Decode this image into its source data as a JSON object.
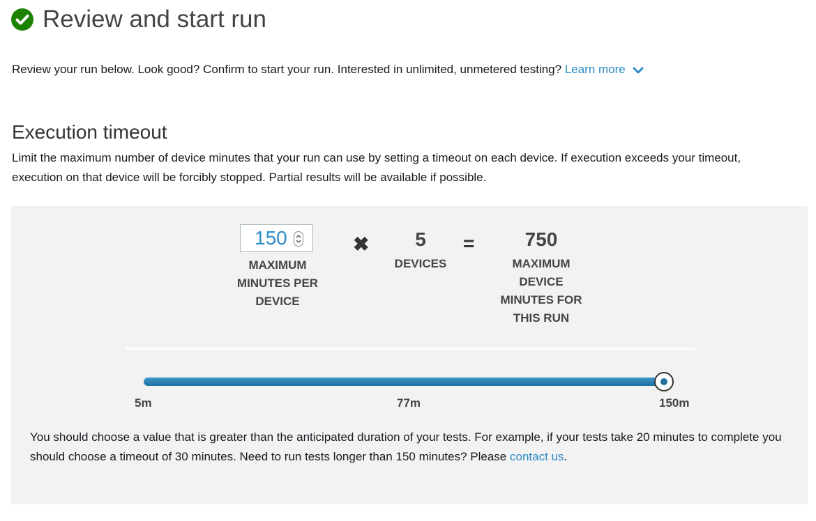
{
  "header": {
    "title": "Review and start run",
    "status_icon": "check-circle-icon",
    "accent_color": "#1d8102"
  },
  "intro": {
    "text": "Review your run below. Look good? Confirm to start your run. Interested in unlimited, unmetered testing? ",
    "link_label": "Learn more"
  },
  "execution_timeout": {
    "title": "Execution timeout",
    "description": "Limit the maximum number of device minutes that your run can use by setting a timeout on each device. If execution exceeds your timeout, execution on that device will be forcibly stopped. Partial results will be available if possible.",
    "minutes_per_device": {
      "value": "150",
      "label": "MAXIMUM MINUTES PER DEVICE"
    },
    "multiply_symbol": "✖",
    "devices": {
      "value": "5",
      "label": "DEVICES"
    },
    "equals_symbol": "=",
    "total": {
      "value": "750",
      "label": "MAXIMUM DEVICE MINUTES FOR THIS RUN"
    },
    "slider": {
      "min_label": "5m",
      "mid_label": "77m",
      "max_label": "150m",
      "current_fraction": 1.0,
      "fill_color": "#1f6f9e"
    },
    "note": {
      "text": "You should choose a value that is greater than the anticipated duration of your tests. For example, if your tests take 20 minutes to complete you should choose a timeout of 30 minutes. Need to run tests longer than 150 minutes? Please ",
      "link_label": "contact us",
      "suffix": "."
    }
  }
}
